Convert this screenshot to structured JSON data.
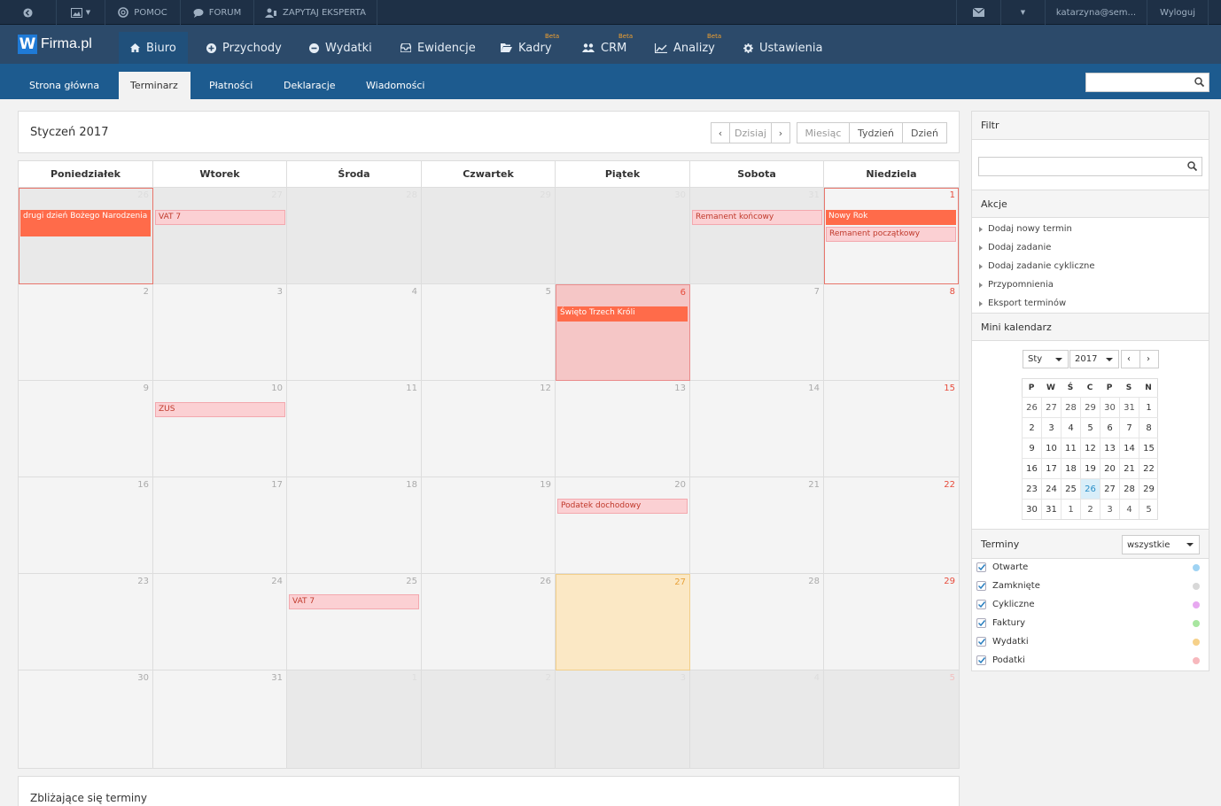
{
  "topbar": {
    "help": "POMOC",
    "forum": "FORUM",
    "ask_expert": "ZAPYTAJ EKSPERTA",
    "user": "katarzyna@sem...",
    "logout": "Wyloguj"
  },
  "brand": {
    "logo_letter": "W",
    "logo_text": "Firma.pl",
    "accent": "#1f7ad6"
  },
  "nav": {
    "items": [
      {
        "label": "Biuro",
        "beta": ""
      },
      {
        "label": "Przychody",
        "beta": ""
      },
      {
        "label": "Wydatki",
        "beta": ""
      },
      {
        "label": "Ewidencje",
        "beta": ""
      },
      {
        "label": "Kadry",
        "beta": "Beta"
      },
      {
        "label": "CRM",
        "beta": "Beta"
      },
      {
        "label": "Analizy",
        "beta": "Beta"
      },
      {
        "label": "Ustawienia",
        "beta": ""
      }
    ]
  },
  "subnav": {
    "items": [
      {
        "label": "Strona główna"
      },
      {
        "label": "Terminarz"
      },
      {
        "label": "Płatności"
      },
      {
        "label": "Deklaracje"
      },
      {
        "label": "Wiadomości"
      }
    ]
  },
  "calendar": {
    "title": "Styczeń 2017",
    "today_btn": "Dzisiaj",
    "view_month": "Miesiąc",
    "view_week": "Tydzień",
    "view_day": "Dzień",
    "weekdays": [
      "Poniedziałek",
      "Wtorek",
      "Środa",
      "Czwartek",
      "Piątek",
      "Sobota",
      "Niedziela"
    ],
    "weeks": [
      [
        "26",
        "27",
        "28",
        "29",
        "30",
        "31",
        "1"
      ],
      [
        "2",
        "3",
        "4",
        "5",
        "6",
        "7",
        "8"
      ],
      [
        "9",
        "10",
        "11",
        "12",
        "13",
        "14",
        "15"
      ],
      [
        "16",
        "17",
        "18",
        "19",
        "20",
        "21",
        "22"
      ],
      [
        "23",
        "24",
        "25",
        "26",
        "27",
        "28",
        "29"
      ],
      [
        "30",
        "31",
        "1",
        "2",
        "3",
        "4",
        "5"
      ]
    ],
    "events": {
      "e1": "drugi dzień Bożego Narodzenia",
      "e2": "VAT 7",
      "e3": "Remanent końcowy",
      "e4": "Nowy Rok",
      "e5": "Remanent początkowy",
      "e6": "Święto Trzech Króli",
      "e7": "ZUS",
      "e8": "Podatek dochodowy",
      "e9": "VAT 7"
    }
  },
  "upcoming": {
    "title": "Zbliżające się terminy"
  },
  "sidebar": {
    "filter_title": "Filtr",
    "filter_placeholder": "",
    "actions_title": "Akcje",
    "actions": [
      "Dodaj nowy termin",
      "Dodaj zadanie",
      "Dodaj zadanie cykliczne",
      "Przypomnienia",
      "Eksport terminów"
    ],
    "mini_title": "Mini kalendarz",
    "mini_month": "Sty",
    "mini_year": "2017",
    "mini_headers": [
      "P",
      "W",
      "Ś",
      "C",
      "P",
      "S",
      "N"
    ],
    "mini_weeks": [
      [
        "26",
        "27",
        "28",
        "29",
        "30",
        "31",
        "1"
      ],
      [
        "2",
        "3",
        "4",
        "5",
        "6",
        "7",
        "8"
      ],
      [
        "9",
        "10",
        "11",
        "12",
        "13",
        "14",
        "15"
      ],
      [
        "16",
        "17",
        "18",
        "19",
        "20",
        "21",
        "22"
      ],
      [
        "23",
        "24",
        "25",
        "26",
        "27",
        "28",
        "29"
      ],
      [
        "30",
        "31",
        "1",
        "2",
        "3",
        "4",
        "5"
      ]
    ],
    "terms_title": "Terminy",
    "terms_select": "wszystkie",
    "terms": [
      {
        "label": "Otwarte",
        "color": "#9fd3f3"
      },
      {
        "label": "Zamknięte",
        "color": "#d8d8d8"
      },
      {
        "label": "Cykliczne",
        "color": "#e7a8f0"
      },
      {
        "label": "Faktury",
        "color": "#a8e6a0"
      },
      {
        "label": "Wydatki",
        "color": "#f6d18a"
      },
      {
        "label": "Podatki",
        "color": "#f7b8bd"
      }
    ]
  }
}
